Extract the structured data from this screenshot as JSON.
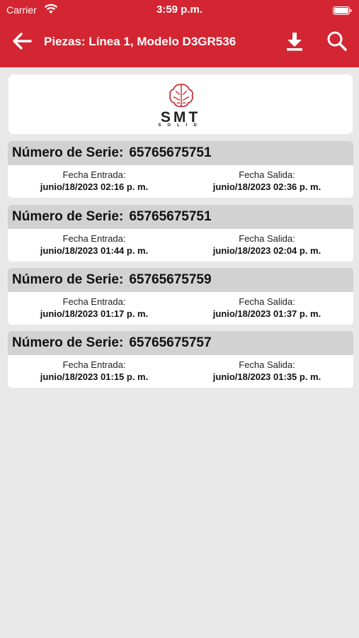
{
  "status_bar": {
    "carrier": "Carrier",
    "time": "3:59 p.m."
  },
  "navbar": {
    "title": "Piezas: Línea 1, Modelo D3GR536"
  },
  "logo": {
    "text": "SMT",
    "subtext": "SOLID"
  },
  "colors": {
    "header": "#d42532",
    "card_head": "#d2d2d2",
    "background": "#e8e8e8"
  },
  "icons": [
    "back-arrow-icon",
    "download-icon",
    "search-icon",
    "brain-icon",
    "wifi-icon",
    "battery-icon"
  ],
  "records": [
    {
      "serie_label": "Número de Serie:",
      "serie": "65765675751",
      "entrada_label": "Fecha Entrada:",
      "entrada": "junio/18/2023 02:16 p. m.",
      "salida_label": "Fecha Salida:",
      "salida": "junio/18/2023 02:36 p. m."
    },
    {
      "serie_label": "Número de Serie:",
      "serie": "65765675751",
      "entrada_label": "Fecha Entrada:",
      "entrada": "junio/18/2023 01:44 p. m.",
      "salida_label": "Fecha Salida:",
      "salida": "junio/18/2023 02:04 p. m."
    },
    {
      "serie_label": "Número de Serie:",
      "serie": "65765675759",
      "entrada_label": "Fecha Entrada:",
      "entrada": "junio/18/2023 01:17 p. m.",
      "salida_label": "Fecha Salida:",
      "salida": "junio/18/2023 01:37 p. m."
    },
    {
      "serie_label": "Número de Serie:",
      "serie": "65765675757",
      "entrada_label": "Fecha Entrada:",
      "entrada": "junio/18/2023 01:15 p. m.",
      "salida_label": "Fecha Salida:",
      "salida": "junio/18/2023 01:35 p. m."
    }
  ]
}
